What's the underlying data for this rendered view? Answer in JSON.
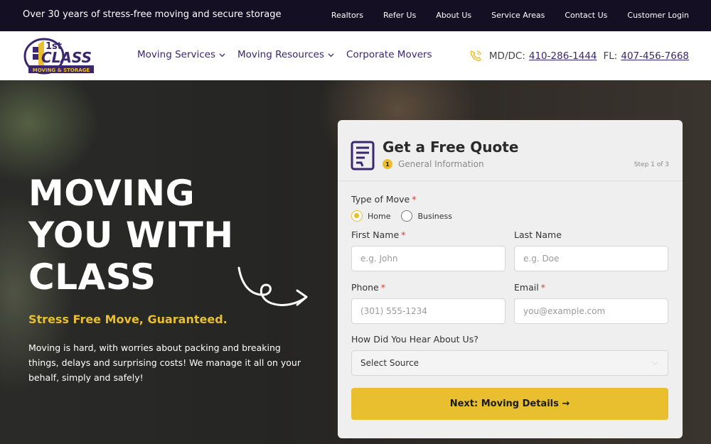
{
  "topbar": {
    "tagline": "Over 30 years of stress-free moving and secure storage",
    "links": [
      "Realtors",
      "Refer Us",
      "About Us",
      "Service Areas",
      "Contact Us",
      "Customer Login"
    ]
  },
  "header": {
    "logo": {
      "top": "1st",
      "main": "CLASS",
      "sub": "MOVING & STORAGE"
    },
    "nav": [
      {
        "label": "Moving Services"
      },
      {
        "label": "Moving Resources"
      },
      {
        "label": "Corporate Movers"
      }
    ],
    "phones": {
      "md_label": "MD/DC:",
      "md_number": "410-286-1444",
      "fl_label": "FL:",
      "fl_number": "407-456-7668"
    }
  },
  "hero": {
    "title_lines": [
      "MOVING",
      "YOU WITH",
      "CLASS"
    ],
    "subtitle": "Stress Free Move, Guaranteed.",
    "description": "Moving is hard, with worries about packing and breaking things, delays and surprising costs! We manage it all on your behalf, simply and safely!"
  },
  "quote_form": {
    "title": "Get a Free Quote",
    "step_number": "1",
    "step_name": "General Information",
    "step_count": "Step 1 of 3",
    "type_of_move_label": "Type of Move",
    "required_mark": "*",
    "move_options": [
      "Home",
      "Business"
    ],
    "selected_move": "Home",
    "first_name_label": "First Name",
    "first_name_placeholder": "e.g. John",
    "last_name_label": "Last Name",
    "last_name_placeholder": "e.g. Doe",
    "phone_label": "Phone",
    "phone_placeholder": "(301) 555-1234",
    "email_label": "Email",
    "email_placeholder": "you@example.com",
    "source_label": "How Did You Hear About Us?",
    "source_value": "Select Source",
    "submit_label": "Next: Moving Details →"
  },
  "colors": {
    "accent": "#e9bf2f",
    "brand": "#3a2770",
    "topbar_bg": "#140f22"
  }
}
